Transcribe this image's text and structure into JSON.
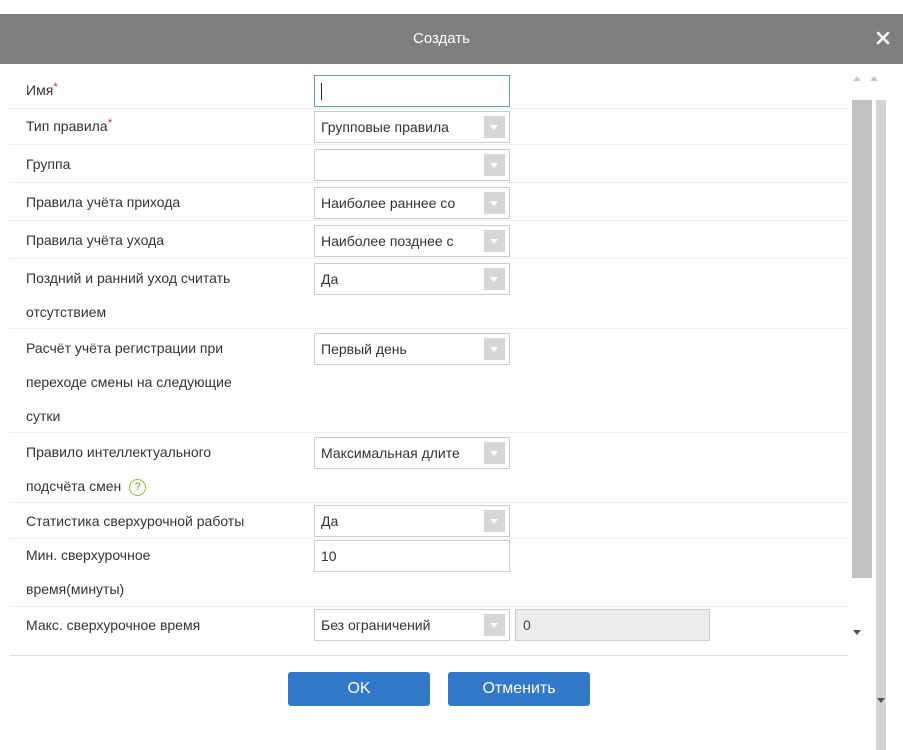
{
  "dialog": {
    "title": "Создать",
    "close_icon": "close-icon"
  },
  "form": {
    "name": {
      "label": "Имя",
      "required_mark": "*",
      "value": ""
    },
    "rule_type": {
      "label": "Тип правила",
      "required_mark": "*",
      "value": "Групповые правила"
    },
    "group": {
      "label": "Группа",
      "value": ""
    },
    "checkin_rule": {
      "label": "Правила учёта прихода",
      "value": "Наиболее раннее со"
    },
    "checkout_rule": {
      "label": "Правила учёта ухода",
      "value": "Наиболее позднее с"
    },
    "late_early_absence": {
      "label_line1": "Поздний и ранний уход считать",
      "label_line2": "отсутствием",
      "value": "Да"
    },
    "cross_day": {
      "label_line1": "Расчёт учёта регистрации при",
      "label_line2": "переходе смены на следующие",
      "label_line3": "сутки",
      "value": "Первый день"
    },
    "smart_shift": {
      "label_line1": "Правило интеллектуального",
      "label_line2": "подсчёта смен",
      "help_icon": "question-circle-icon",
      "help_glyph": "?",
      "value": "Максимальная длите"
    },
    "overtime_stats": {
      "label": "Статистика сверхурочной работы",
      "value": "Да"
    },
    "min_overtime": {
      "label_line1": "Мин. сверхурочное",
      "label_line2": "время(минуты)",
      "value": "10"
    },
    "max_overtime": {
      "label": "Макс. сверхурочное время",
      "value": "Без ограничений",
      "extra_value": "0"
    }
  },
  "buttons": {
    "ok": "OK",
    "cancel": "Отменить"
  },
  "colors": {
    "titlebar": "#7f7f7f",
    "primary_button": "#3379c9",
    "required": "#e53935",
    "help": "#8cc63f"
  }
}
